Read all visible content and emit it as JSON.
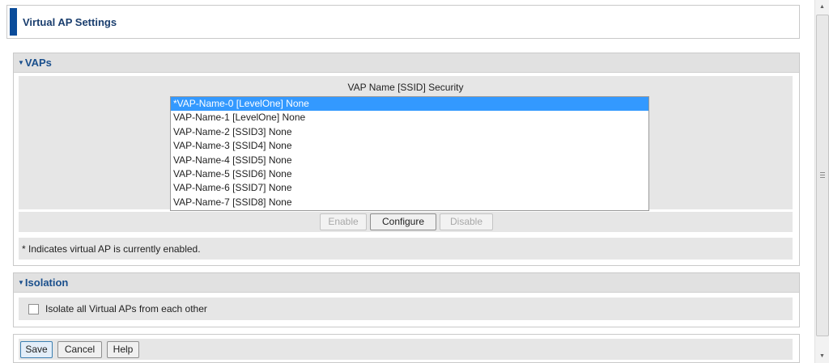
{
  "page": {
    "title": "Virtual AP Settings"
  },
  "vaps": {
    "header": "VAPs",
    "column_title": "VAP Name [SSID] Security",
    "list": [
      "*VAP-Name-0 [LevelOne] None",
      "VAP-Name-1 [LevelOne] None",
      "VAP-Name-2 [SSID3] None",
      "VAP-Name-3 [SSID4] None",
      "VAP-Name-4 [SSID5] None",
      "VAP-Name-5 [SSID6] None",
      "VAP-Name-6 [SSID7] None",
      "VAP-Name-7 [SSID8] None"
    ],
    "selected_index": 0,
    "buttons": {
      "enable": "Enable",
      "configure": "Configure",
      "disable": "Disable"
    },
    "note": "* Indicates virtual AP is currently enabled."
  },
  "isolation": {
    "header": "Isolation",
    "checkbox_label": "Isolate all Virtual APs from each other",
    "checked": false
  },
  "footer": {
    "save": "Save",
    "cancel": "Cancel",
    "help": "Help"
  },
  "colors": {
    "accent": "#0a4c9a",
    "header_text": "#1a4f8c",
    "selection": "#3399ff",
    "panel": "#e6e6e6"
  },
  "icons": {
    "collapse": "triangle-down-icon",
    "scroll_up": "arrow-up-icon",
    "scroll_down": "arrow-down-icon",
    "scroll_grip": "grip-icon"
  }
}
